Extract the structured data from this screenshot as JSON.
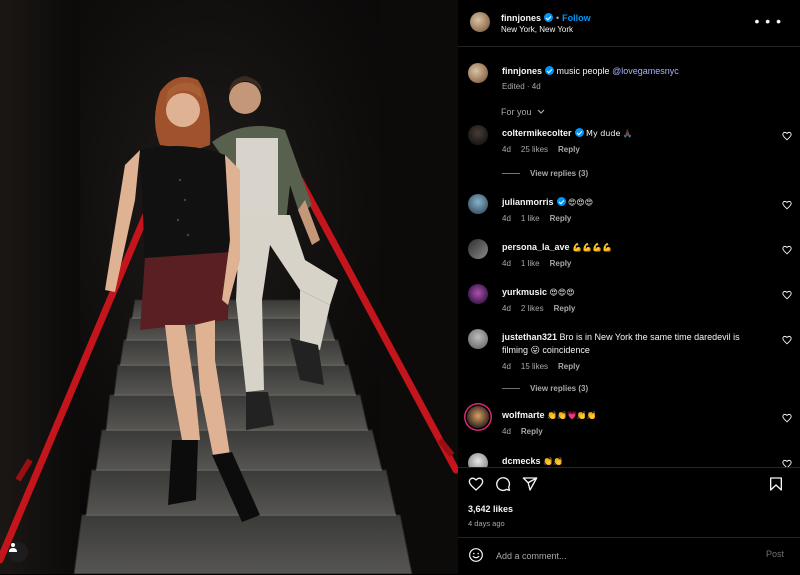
{
  "post": {
    "author": "finnjones",
    "follow_label": "Follow",
    "location": "New York, New York"
  },
  "caption": {
    "author": "finnjones",
    "text": "music people",
    "mention": "@lovegamesnyc",
    "meta": "Edited · 4d"
  },
  "sort_label": "For you",
  "comments": [
    {
      "user": "coltermikecolter",
      "text": "My dude 🙏🏿",
      "time": "4d",
      "likes": "25 likes",
      "reply": "Reply",
      "view_replies": "View replies (3)",
      "verified": true
    },
    {
      "user": "julianmorris",
      "text": "😍😍😍",
      "time": "4d",
      "likes": "1 like",
      "reply": "Reply",
      "verified": true
    },
    {
      "user": "persona_la_ave",
      "text": "💪💪💪💪",
      "time": "4d",
      "likes": "1 like",
      "reply": "Reply"
    },
    {
      "user": "yurkmusic",
      "text": "😍😍😍",
      "time": "4d",
      "likes": "2 likes",
      "reply": "Reply"
    },
    {
      "user": "justethan321",
      "text": "Bro is in New York the same time daredevil is filming 😛 coincidence",
      "time": "4d",
      "likes": "15 likes",
      "reply": "Reply",
      "view_replies": "View replies (3)"
    },
    {
      "user": "wolfmarte",
      "text": "👏👏💗👏👏",
      "time": "4d",
      "reply": "Reply"
    },
    {
      "user": "dcmecks",
      "text": "👏👏"
    }
  ],
  "likes_count": "3,642 likes",
  "time_ago": "4 days ago",
  "comment_input": {
    "placeholder": "Add a comment...",
    "post_label": "Post"
  },
  "colors": {
    "accent": "#0095f6",
    "mention": "#a9b2ff",
    "railing": "#c4151c",
    "background": "#000000"
  },
  "icons": [
    "more-options-icon",
    "heart-icon",
    "comment-icon",
    "share-icon",
    "bookmark-icon",
    "emoji-icon",
    "user-tag-icon",
    "verified-badge-icon",
    "chevron-down-icon"
  ]
}
